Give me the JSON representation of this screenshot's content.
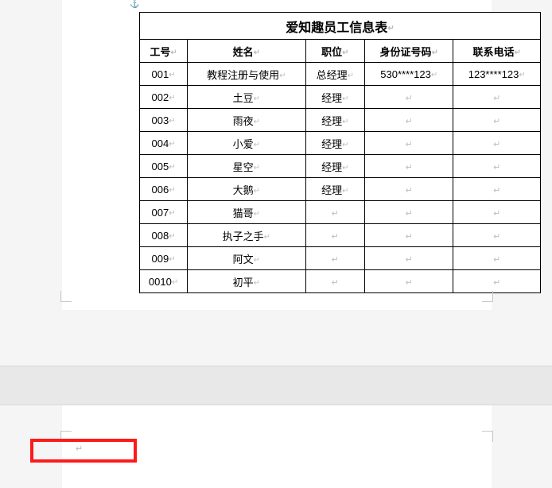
{
  "title": "爱知趣员工信息表",
  "headers": [
    "工号",
    "姓名",
    "职位",
    "身份证号码",
    "联系电话"
  ],
  "rows": [
    {
      "id": "001",
      "name": "教程注册与使用",
      "position": "总经理",
      "idcard": "530****123",
      "phone": "123****123"
    },
    {
      "id": "002",
      "name": "土豆",
      "position": "经理",
      "idcard": "",
      "phone": ""
    },
    {
      "id": "003",
      "name": "雨夜",
      "position": "经理",
      "idcard": "",
      "phone": ""
    },
    {
      "id": "004",
      "name": "小爱",
      "position": "经理",
      "idcard": "",
      "phone": ""
    },
    {
      "id": "005",
      "name": "星空",
      "position": "经理",
      "idcard": "",
      "phone": ""
    },
    {
      "id": "006",
      "name": "大鹅",
      "position": "经理",
      "idcard": "",
      "phone": ""
    },
    {
      "id": "007",
      "name": "猫哥",
      "position": "",
      "idcard": "",
      "phone": ""
    },
    {
      "id": "008",
      "name": "执子之手",
      "position": "",
      "idcard": "",
      "phone": ""
    },
    {
      "id": "009",
      "name": "阿文",
      "position": "",
      "idcard": "",
      "phone": ""
    },
    {
      "id": "0010",
      "name": "初平",
      "position": "",
      "idcard": "",
      "phone": ""
    }
  ],
  "paragraphMark": "↵",
  "anchorMark": "⚓"
}
